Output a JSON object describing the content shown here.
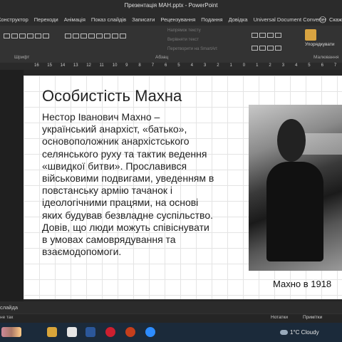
{
  "window": {
    "title": "Презентація МАН.pptx  -  PowerPoint"
  },
  "ribbon_tabs": [
    "Конструктор",
    "Переходи",
    "Анімація",
    "Показ слайдів",
    "Записати",
    "Рецензування",
    "Подання",
    "Довідка",
    "Universal Document Converter"
  ],
  "search": {
    "label": "Скаж"
  },
  "ribbon": {
    "font_group": "Шрифт",
    "paragraph_group": "Абзац",
    "drawing_group": "Малювання",
    "arrange_button": "Упорядкувати",
    "text_direction": "Напрямок тексту",
    "align_text": "Вирівняти текст",
    "convert_smartart": "Перетворити на SmartArt"
  },
  "ruler": {
    "ticks": [
      "16",
      "15",
      "14",
      "13",
      "12",
      "11",
      "10",
      "9",
      "8",
      "7",
      "6",
      "5",
      "4",
      "3",
      "2",
      "1",
      "0",
      "1",
      "2",
      "3",
      "4",
      "5",
      "6",
      "7"
    ]
  },
  "slide": {
    "title": "Особистість Махна",
    "body": "Нестор Іванович Махно – український анархіст, «батько», основоположник анархістського селянського руху та тактик ведення «швидкої битви». Прославився військовими подвигами, уведенням в повстанську армію тачанок і ідеологічними працями, на основі яких будував безвладне суспільство. Довів, що люди можуть співіснувати в умовах самоврядування та взаємодопомоги.",
    "caption": "Махно в 1918"
  },
  "notes": {
    "placeholder": "слайда"
  },
  "status": {
    "left": "не так",
    "notes_button": "Нотатки",
    "comments_button": "Примітки"
  },
  "taskbar": {
    "weather_temp": "1°C",
    "weather_desc": "Cloudy"
  },
  "colors": {
    "ribbon_bg": "#333333",
    "taskbar_bg": "#1b2a3a",
    "powerpoint_accent": "#c43e1c"
  }
}
